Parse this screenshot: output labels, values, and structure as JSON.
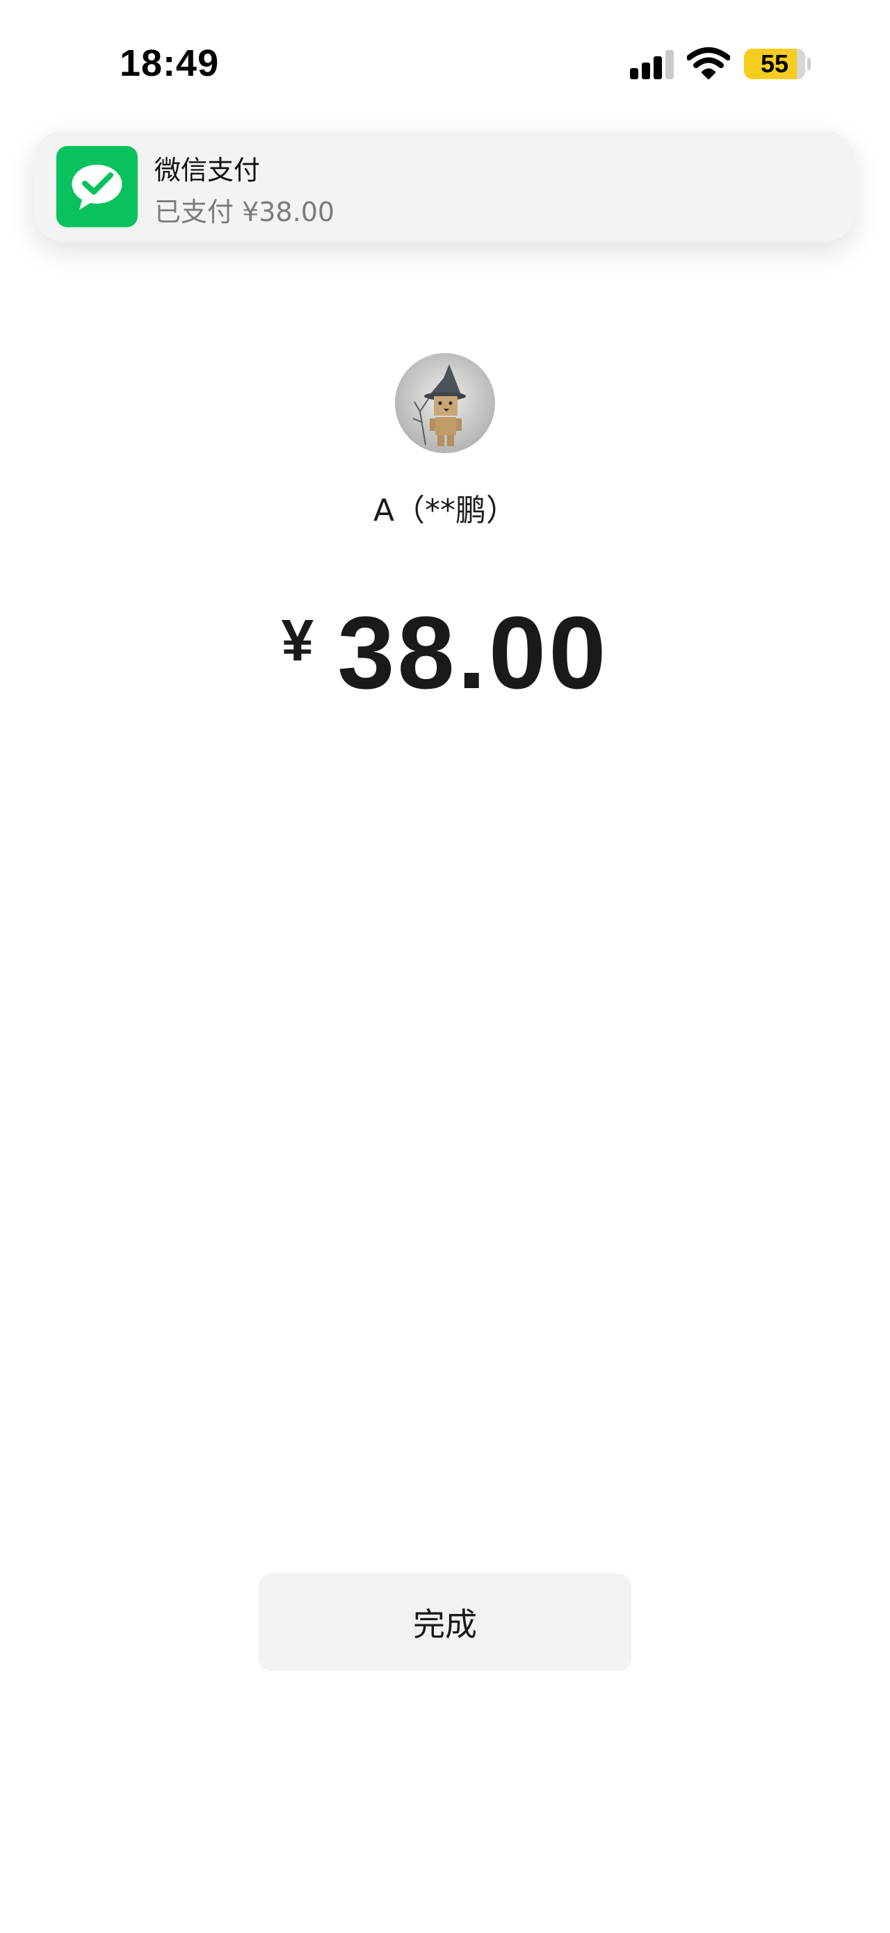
{
  "status_bar": {
    "time": "18:49",
    "battery_level": "55",
    "battery_color": "#f7cd1f",
    "signal_icon": "cellular-signal-icon",
    "wifi_icon": "wifi-icon"
  },
  "notification": {
    "app_name": "微信支付",
    "message": "已支付 ¥38.00",
    "icon": "wechat-pay-icon",
    "icon_color": "#09c25e"
  },
  "payment": {
    "payee": "A（**鹏）",
    "currency_symbol": "¥",
    "amount": "38.00",
    "avatar": "payee-avatar-danbo-witch"
  },
  "actions": {
    "done_label": "完成"
  }
}
